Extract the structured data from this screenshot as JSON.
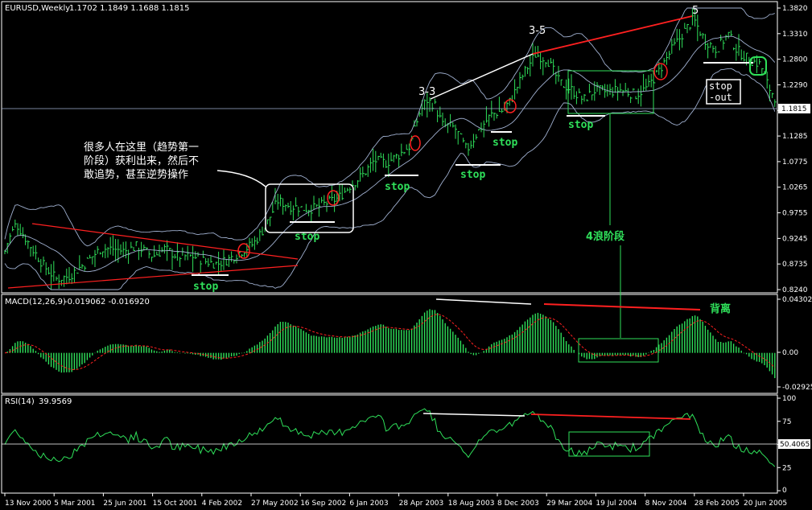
{
  "chart_data": [
    {
      "type": "bar",
      "name": "price",
      "header": {
        "symbol": "EURUSD,Weekly",
        "ohlc": "1.1702 1.1849 1.1688 1.1815"
      },
      "ylim": [
        0.824,
        1.382
      ],
      "yticks": [
        "1.3820",
        "1.3310",
        "1.2800",
        "1.2290",
        "1.1785",
        "1.1285",
        "1.0775",
        "1.0265",
        "0.9755",
        "0.9245",
        "0.8735",
        "0.8240"
      ],
      "current_price": "1.1815",
      "close_path": [
        [
          0,
          0.87
        ],
        [
          10,
          0.92
        ],
        [
          20,
          0.955
        ],
        [
          40,
          0.905
        ],
        [
          55,
          0.87
        ],
        [
          70,
          0.845
        ],
        [
          85,
          0.85
        ],
        [
          105,
          0.875
        ],
        [
          125,
          0.905
        ],
        [
          140,
          0.905
        ],
        [
          155,
          0.9
        ],
        [
          170,
          0.91
        ],
        [
          190,
          0.89
        ],
        [
          205,
          0.905
        ],
        [
          220,
          0.89
        ],
        [
          240,
          0.89
        ],
        [
          255,
          0.88
        ],
        [
          270,
          0.875
        ],
        [
          285,
          0.885
        ],
        [
          300,
          0.9
        ],
        [
          315,
          0.915
        ],
        [
          330,
          0.95
        ],
        [
          345,
          1.0
        ],
        [
          360,
          0.99
        ],
        [
          375,
          0.985
        ],
        [
          390,
          0.985
        ],
        [
          405,
          0.995
        ],
        [
          420,
          1.005
        ],
        [
          435,
          1.03
        ],
        [
          450,
          1.05
        ],
        [
          465,
          1.08
        ],
        [
          480,
          1.075
        ],
        [
          495,
          1.09
        ],
        [
          510,
          1.11
        ],
        [
          520,
          1.17
        ],
        [
          530,
          1.2
        ],
        [
          540,
          1.19
        ],
        [
          550,
          1.15
        ],
        [
          565,
          1.145
        ],
        [
          580,
          1.1
        ],
        [
          595,
          1.14
        ],
        [
          610,
          1.17
        ],
        [
          625,
          1.18
        ],
        [
          635,
          1.2
        ],
        [
          650,
          1.25
        ],
        [
          665,
          1.29
        ],
        [
          680,
          1.28
        ],
        [
          695,
          1.235
        ],
        [
          710,
          1.22
        ],
        [
          725,
          1.2
        ],
        [
          740,
          1.22
        ],
        [
          755,
          1.215
        ],
        [
          770,
          1.22
        ],
        [
          790,
          1.21
        ],
        [
          805,
          1.225
        ],
        [
          820,
          1.26
        ],
        [
          835,
          1.3
        ],
        [
          850,
          1.335
        ],
        [
          862,
          1.36
        ],
        [
          875,
          1.32
        ],
        [
          890,
          1.3
        ],
        [
          905,
          1.33
        ],
        [
          915,
          1.3
        ],
        [
          930,
          1.28
        ],
        [
          945,
          1.27
        ],
        [
          955,
          1.225
        ],
        [
          965,
          1.2
        ]
      ],
      "annotations": {
        "wave_3_3": "3-3",
        "wave_3_5": "3-5",
        "wave_5": "5",
        "stop": "stop",
        "stop_out": "stop\n-out",
        "note_line1": "很多人在这里（趋势第一",
        "note_line2": "阶段）获利出来，然后不",
        "note_line3": "敢追势，甚至逆势操作",
        "wave4": "4浪阶段"
      }
    },
    {
      "type": "bar",
      "name": "macd",
      "header": {
        "label": "MACD(12,26,9)",
        "values": "-0.019062  -0.016920"
      },
      "ylim": [
        -0.02925,
        0.04302
      ],
      "yticks": [
        "0.04302",
        "0.00",
        "-0.02925"
      ],
      "annotation": "背离"
    },
    {
      "type": "line",
      "name": "rsi",
      "header": {
        "label": "RSI(14)",
        "value": "39.9569"
      },
      "ylim": [
        0,
        100
      ],
      "yticks": [
        "100",
        "75",
        "50",
        "25",
        "0"
      ],
      "current": "50.4065"
    }
  ],
  "xaxis": {
    "labels": [
      "13 Nov 2000",
      "5 Mar 2001",
      "25 Jun 2001",
      "15 Oct 2001",
      "4 Feb 2002",
      "27 May 2002",
      "16 Sep 2002",
      "6 Jan 2003",
      "28 Apr 2003",
      "18 Aug 2003",
      "8 Dec 2003",
      "29 Mar 2004",
      "19 Jul 2004",
      "8 Nov 2004",
      "28 Feb 2005",
      "20 Jun 2005"
    ]
  },
  "colors": {
    "bars": "#2fe05a",
    "bands": "#a0b0d0",
    "red": "#ff2020",
    "white": "#ffffff",
    "signal": "#ff2020"
  }
}
